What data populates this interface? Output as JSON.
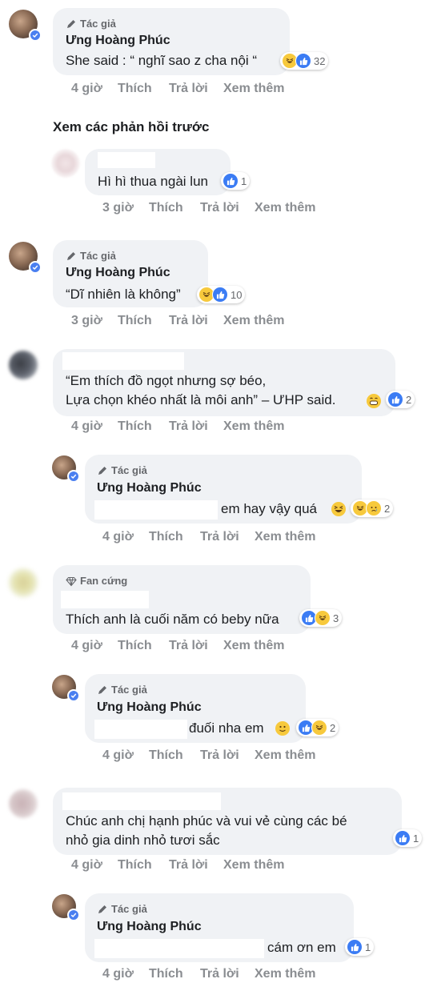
{
  "labels": {
    "author_badge": "Tác giả",
    "fan_badge": "Fan cứng",
    "see_previous": "Xem các phản hồi trước"
  },
  "actions": {
    "like": "Thích",
    "reply": "Trả lời",
    "more": "Xem thêm"
  },
  "author_name": "Ưng Hoàng Phúc",
  "comments": [
    {
      "text": "She said : “ nghĩ sao z cha nội “",
      "time": "4 giờ",
      "reactions": [
        "haha",
        "like"
      ],
      "count": "32"
    },
    {
      "text": "Hì hì thua ngài lun",
      "time": "3 giờ",
      "reactions": [
        "like"
      ],
      "count": "1"
    },
    {
      "text": "“Dĩ nhiên là không”",
      "time": "3 giờ",
      "reactions": [
        "haha",
        "like"
      ],
      "count": "10"
    },
    {
      "text_line1": "“Em thích đồ ngọt nhưng sợ béo,",
      "text_line2": "Lựa chọn khéo nhất là môi anh” – ƯHP said.",
      "time": "4 giờ",
      "reactions": [
        "like"
      ],
      "count": "2"
    },
    {
      "text": "em hay vậy quá",
      "time": "4 giờ",
      "reactions": [
        "haha",
        "sad"
      ],
      "count": "2"
    },
    {
      "text": "Thích anh là cuối năm có beby nữa",
      "time": "4 giờ",
      "reactions": [
        "like",
        "haha"
      ],
      "count": "3"
    },
    {
      "text": "đuối nha em",
      "time": "4 giờ",
      "reactions": [
        "like",
        "haha"
      ],
      "count": "2"
    },
    {
      "text_line1": "Chúc anh chị hạnh phúc và vui vẻ cùng các bé",
      "text_line2": "nhỏ gia dinh nhỏ tươi sắc",
      "time": "4 giờ",
      "reactions": [
        "like"
      ],
      "count": "1"
    },
    {
      "text": "cám ơn em",
      "time": "4 giờ",
      "reactions": [
        "like"
      ],
      "count": "1"
    }
  ],
  "colors": {
    "bubble": "#f0f2f5",
    "like": "#3b7cf4",
    "haha": "#f7c93c",
    "muted": "#8a8d91",
    "verified": "#4a7ff0"
  }
}
